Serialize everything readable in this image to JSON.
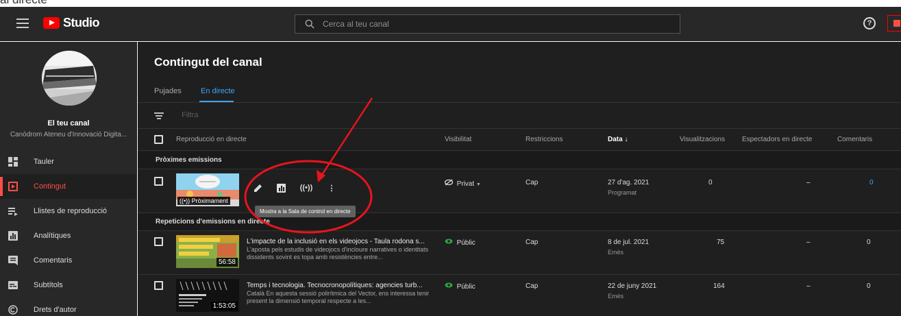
{
  "top_caption": "al directe",
  "topbar": {
    "logo_text": "Studio",
    "search_placeholder": "Cerca al teu canal",
    "help_icon": "?"
  },
  "sidebar": {
    "channel_title": "El teu canal",
    "channel_name": "Canòdrom Ateneu d'Innovació Digita...",
    "items": [
      {
        "label": "Tauler",
        "icon": "dashboard-icon"
      },
      {
        "label": "Contingut",
        "icon": "content-icon",
        "active": true
      },
      {
        "label": "Llistes de reproducció",
        "icon": "playlist-icon"
      },
      {
        "label": "Analítiques",
        "icon": "analytics-icon"
      },
      {
        "label": "Comentaris",
        "icon": "comments-icon"
      },
      {
        "label": "Subtítols",
        "icon": "subtitles-icon"
      },
      {
        "label": "Drets d'autor",
        "icon": "copyright-icon"
      }
    ]
  },
  "main": {
    "title": "Contingut del canal",
    "tabs": [
      {
        "label": "Pujades"
      },
      {
        "label": "En directe",
        "active": true
      }
    ],
    "filter_placeholder": "Filtra",
    "columns": {
      "video": "Reproducció en directe",
      "visibility": "Visibilitat",
      "restrictions": "Restriccions",
      "date": "Data",
      "views": "Visualitzacions",
      "live_viewers": "Espectadors en directe",
      "comments": "Comentaris"
    },
    "sections": {
      "upcoming": "Pròximes emissions",
      "replays": "Repeticions d'emissions en directe"
    },
    "upcoming_row": {
      "badge": "Pròximament",
      "visibility": "Privat",
      "restrictions": "Cap",
      "date": "27 d'ag. 2021",
      "date_sub": "Programat",
      "views": "0",
      "live_viewers": "–",
      "comments": "0",
      "tooltip": "Mostra a la Sala de control en directe"
    },
    "rows": [
      {
        "title": "L'impacte de la inclusió en els videojocs - Taula rodona s...",
        "desc": "L'aposta pels estudis de videojocs d'incloure narratives o identitats dissidents sovint es topa amb resistències entre...",
        "duration": "56:58",
        "visibility": "Públic",
        "restrictions": "Cap",
        "date": "8 de jul. 2021",
        "date_sub": "Emès",
        "views": "75",
        "live_viewers": "–",
        "comments": "0"
      },
      {
        "title": "Temps i tecnologia. Tecnocronopolítiques: agencies turb...",
        "desc": "Català En aquesta sessió polirítmica del Vector, ens interessa tenir present la dimensió temporal respecte a les...",
        "duration": "1:53:05",
        "visibility": "Públic",
        "restrictions": "Cap",
        "date": "22 de juny 2021",
        "date_sub": "Emès",
        "views": "164",
        "live_viewers": "–",
        "comments": "0"
      }
    ]
  },
  "colors": {
    "accent_blue": "#3ea6ff",
    "accent_red": "#ff4e45",
    "annotation_red": "#e8141c",
    "public_green": "#2ba640"
  }
}
